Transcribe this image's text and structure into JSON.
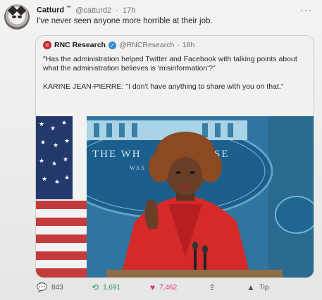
{
  "tweet": {
    "author_name": "Catturd",
    "author_mark": "™",
    "handle": "@catturd2",
    "time": "17h",
    "text": "I've never seen anyone more horrible at their job."
  },
  "quoted": {
    "name": "RNC Research",
    "handle": "@RNCResearch",
    "time": "18h",
    "paragraphs": [
      "\"Has the administration helped Twitter and Facebook with talking points about what the administration believes is 'misinformation'?\"",
      "KARINE JEAN-PIERRE: \"I don't have anything to share with you on that.\""
    ],
    "image": {
      "seal_text_left": "THE WH",
      "seal_text_right": "SE",
      "seal_sub": "WAS"
    }
  },
  "actions": {
    "replies": "843",
    "retweets": "1,691",
    "likes": "7,462",
    "tip_label": "Tip"
  },
  "icons": {
    "more": "more-dots-icon",
    "reply": "reply-icon",
    "retweet": "retweet-icon",
    "like": "heart-icon",
    "share": "share-icon",
    "tip": "tip-icon",
    "verified": "verified-badge-icon"
  },
  "colors": {
    "retweet": "#1e9a63",
    "like": "#d9317b",
    "verified": "#2f8bd6",
    "rnc_logo": "#c6282c"
  }
}
